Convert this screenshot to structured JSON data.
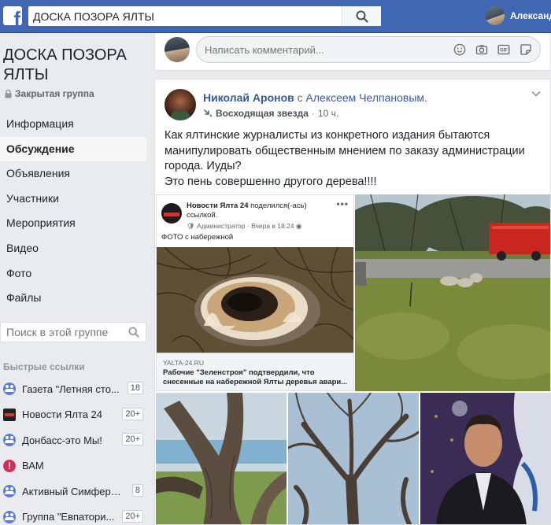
{
  "header": {
    "logo_letter": "f",
    "search_value": "ДОСКА ПОЗОРА ЯЛТЫ",
    "username": "Александ"
  },
  "group": {
    "title": "ДОСКА ПОЗОРА ЯЛТЫ",
    "type": "Закрытая группа",
    "nav": [
      "Информация",
      "Обсуждение",
      "Объявления",
      "Участники",
      "Мероприятия",
      "Видео",
      "Фото",
      "Файлы"
    ],
    "search_placeholder": "Поиск в этой группе"
  },
  "quick_links": {
    "header": "Быстрые ссылки",
    "items": [
      {
        "label": "Газета \"Летняя сто...",
        "count": "18",
        "icon": "group-icon"
      },
      {
        "label": "Новости Ялта 24",
        "count": "20+",
        "icon": "news-icon"
      },
      {
        "label": "Донбасс-это Мы!",
        "count": "20+",
        "icon": "group-icon"
      },
      {
        "label": "ВАМ",
        "count": "",
        "icon": "bam-icon"
      },
      {
        "label": "Активный Симферо...",
        "count": "8",
        "icon": "group-icon"
      },
      {
        "label": "Группа \"Евпатори...",
        "count": "20+",
        "icon": "group-icon"
      }
    ]
  },
  "composer": {
    "placeholder": "Написать комментарий..."
  },
  "post": {
    "author": "Николай Аронов",
    "with_text": "с",
    "tagged": "Алексеем Челпановым.",
    "badge": "Восходящая звезда",
    "time": "10 ч.",
    "text_lines": [
      "Как ялтинские журналисты из конкретного издания бытаются",
      "манипулировать общественным мнением по заказу администрации",
      "города. Иуды?",
      "Это пень совершенно другого дерева!!!!"
    ],
    "shared": {
      "page_name": "Новости Ялта 24",
      "action": "поделился(-ась)",
      "action2": "ссылкой.",
      "role": "Администратор",
      "when": "Вчера в 18:24",
      "caption": "ФОТО с набережной",
      "domain": "YALTA-24.RU",
      "link_title": "Рабочие \"Зеленстроя\" подтвердили, что снесенные на набережной Ялты деревья авари..."
    }
  },
  "colors": {
    "brand": "#4267b2",
    "link": "#385898",
    "background": "#e9ebee"
  }
}
